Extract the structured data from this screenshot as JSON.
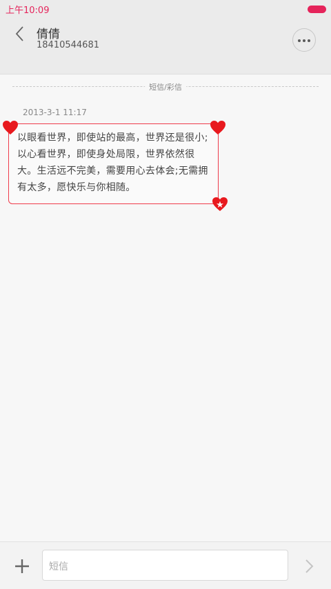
{
  "status_bar": {
    "time": "上午10:09"
  },
  "header": {
    "name": "倩倩",
    "number": "18410544681"
  },
  "thread": {
    "divider_label": "短信/彩信",
    "messages": [
      {
        "timestamp": "2013-3-1 11:17",
        "text": "以眼看世界，即使站的最高，世界还是很小;以心看世界，即使身处局限，世界依然很大。生活远不完美，需要用心去体会;无需拥有太多，愿快乐与你相随。"
      }
    ]
  },
  "composer": {
    "placeholder": "短信"
  },
  "icons": {
    "back": "chevron-left-icon",
    "more": "more-horizontal-icon",
    "add": "plus-icon",
    "send": "chevron-right-icon",
    "heart": "heart-icon"
  },
  "colors": {
    "accent": "#e5245b",
    "bubble_border": "#ef3a4a",
    "heart": "#e8191e"
  }
}
